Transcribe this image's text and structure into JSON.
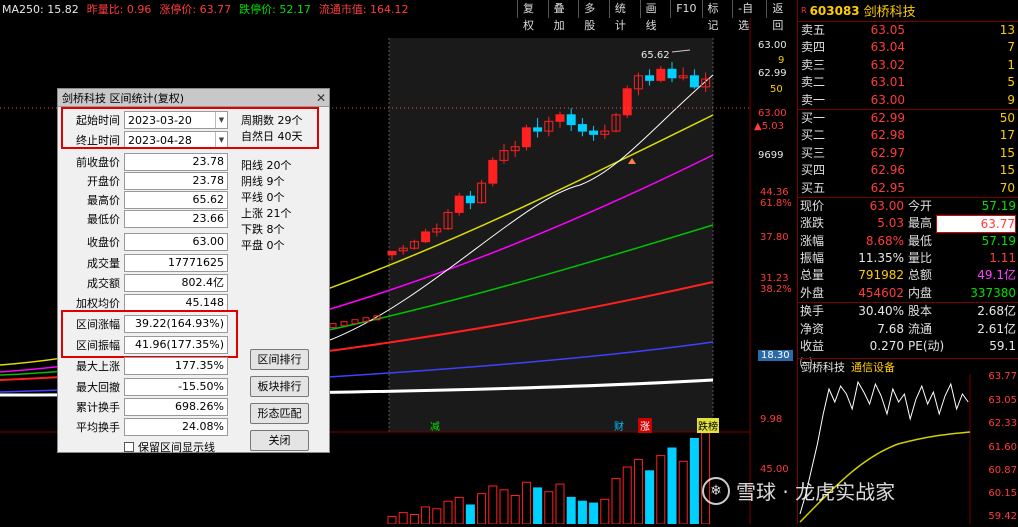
{
  "topbar": {
    "ma250": "MA250: 15.82",
    "prev_close_ratio": "昨量比: 0.96",
    "limit_up": "涨停价: 63.77",
    "limit_down": "跌停价: 52.17",
    "float_value": "流通市值: 164.12"
  },
  "toolbar": [
    "复权",
    "叠加",
    "多股",
    "统计",
    "画线",
    "F10",
    "标记",
    "-自选",
    "返回"
  ],
  "price_axis": [
    "63.00",
    "62.99",
    "50",
    "9",
    "63.00",
    "▲5.03",
    "9699",
    "44.36",
    "61.8%",
    "37.80",
    "31.23",
    "38.2%",
    "18.30",
    "9.98",
    "45.00"
  ],
  "chart": {
    "high_label": "65.62",
    "markers": [
      "减",
      "财",
      "涨",
      "跌榜"
    ],
    "colors": {
      "up": "#ff2020",
      "down": "#00d0ff",
      "ma5": "#ffffff",
      "ma10": "#ffff00",
      "ma20": "#ff00ff",
      "ma60": "#00c000",
      "ma120": "#ff3030",
      "ma250": "#4040ff"
    },
    "candles": [
      [
        36,
        36.5,
        35.2,
        36.6
      ],
      [
        36.6,
        37,
        36,
        37.5
      ],
      [
        37,
        38,
        36.8,
        38.3
      ],
      [
        38,
        39.5,
        37.8,
        40
      ],
      [
        39.5,
        40,
        38.8,
        40.8
      ],
      [
        40,
        42.5,
        39.8,
        43
      ],
      [
        42.5,
        45,
        42,
        45.5
      ],
      [
        45,
        44,
        43,
        45.8
      ],
      [
        44,
        47,
        43.8,
        47.5
      ],
      [
        47,
        50.5,
        46.5,
        51
      ],
      [
        50.5,
        52,
        50,
        53
      ],
      [
        52,
        52.6,
        51,
        53.5
      ],
      [
        52.6,
        55.5,
        52,
        56
      ],
      [
        55.5,
        55,
        54,
        57
      ],
      [
        55,
        56.5,
        54.2,
        57.2
      ],
      [
        56.5,
        57.5,
        55.5,
        58
      ],
      [
        57.5,
        56,
        55,
        58.5
      ],
      [
        56,
        55,
        54.2,
        57
      ],
      [
        55,
        54.5,
        53.5,
        55.8
      ],
      [
        54.5,
        55,
        53.8,
        56
      ],
      [
        55,
        57.5,
        54.8,
        57.8
      ],
      [
        57.5,
        61.5,
        57,
        62
      ],
      [
        61.5,
        63.5,
        60.5,
        64
      ],
      [
        63.5,
        62.8,
        62,
        64.5
      ],
      [
        62.8,
        64.5,
        62.5,
        65
      ],
      [
        64.5,
        63.2,
        62.5,
        65.62
      ],
      [
        63.2,
        63.5,
        62.8,
        64.8
      ],
      [
        63.5,
        61.8,
        61.5,
        64.5
      ],
      [
        61.8,
        63,
        61,
        64
      ]
    ]
  },
  "quote": {
    "code": "603083",
    "name": "剑桥科技",
    "tag": "R",
    "asks": [
      {
        "label": "卖五",
        "price": "63.05",
        "vol": "13"
      },
      {
        "label": "卖四",
        "price": "63.04",
        "vol": "7"
      },
      {
        "label": "卖三",
        "price": "63.02",
        "vol": "1"
      },
      {
        "label": "卖二",
        "price": "63.01",
        "vol": "5"
      },
      {
        "label": "卖一",
        "price": "63.00",
        "vol": "9"
      }
    ],
    "bids": [
      {
        "label": "买一",
        "price": "62.99",
        "vol": "50"
      },
      {
        "label": "买二",
        "price": "62.98",
        "vol": "17"
      },
      {
        "label": "买三",
        "price": "62.97",
        "vol": "15"
      },
      {
        "label": "买四",
        "price": "62.96",
        "vol": "15"
      },
      {
        "label": "买五",
        "price": "62.95",
        "vol": "70"
      }
    ],
    "stats1": [
      {
        "a": "现价",
        "b": "63.00",
        "c": "今开",
        "d": "57.19"
      },
      {
        "a": "涨跌",
        "b": "5.03",
        "c": "最高",
        "d": "63.77"
      },
      {
        "a": "涨幅",
        "b": "8.68%",
        "c": "最低",
        "d": "57.19"
      },
      {
        "a": "振幅",
        "b": "11.35%",
        "c": "量比",
        "d": "1.11"
      },
      {
        "a": "总量",
        "b": "791982",
        "c": "总额",
        "d": "49.1亿"
      },
      {
        "a": "外盘",
        "b": "454602",
        "c": "内盘",
        "d": "337380"
      }
    ],
    "stats2": [
      {
        "a": "换手",
        "b": "30.40%",
        "c": "股本",
        "d": "2.68亿"
      },
      {
        "a": "净资",
        "b": "7.68",
        "c": "流通",
        "d": "2.61亿"
      },
      {
        "a": "收益㈠",
        "b": "0.270",
        "c": "PE(动)",
        "d": "59.1"
      }
    ],
    "mini_title": "剑桥科技",
    "mini_sector": "通信设备",
    "mini_axis": [
      "63.77",
      "63.05",
      "62.33",
      "61.60",
      "60.87",
      "60.15",
      "59.42"
    ]
  },
  "dialog": {
    "title": "剑桥科技 区间统计(复权)",
    "close": "✕",
    "start_label": "起始时间",
    "start_value": "2023-03-20",
    "end_label": "终止时间",
    "end_value": "2023-04-28",
    "period_count": "周期数 29个",
    "natural_days": "自然日 40天",
    "fields": [
      {
        "label": "前收盘价",
        "value": "23.78"
      },
      {
        "label": "开盘价",
        "value": "23.78"
      },
      {
        "label": "最高价",
        "value": "65.62"
      },
      {
        "label": "最低价",
        "value": "23.66"
      },
      {
        "label": "收盘价",
        "value": "63.00"
      },
      {
        "label": "成交量",
        "value": "17771625"
      },
      {
        "label": "成交额",
        "value": "802.4亿"
      },
      {
        "label": "加权均价",
        "value": "45.148"
      },
      {
        "label": "区间涨幅",
        "value": "39.22(164.93%)"
      },
      {
        "label": "区间振幅",
        "value": "41.96(177.35%)"
      },
      {
        "label": "最大上涨",
        "value": "177.35%"
      },
      {
        "label": "最大回撤",
        "value": "-15.50%"
      },
      {
        "label": "累计换手",
        "value": "698.26%"
      },
      {
        "label": "平均换手",
        "value": "24.08%"
      }
    ],
    "counts": [
      "阳线 20个",
      "阴线 9个",
      "平线 0个",
      "上涨 21个",
      "下跌 8个",
      "平盘 0个"
    ],
    "buttons": [
      "区间排行",
      "板块排行",
      "形态匹配",
      "关闭"
    ],
    "checkbox_label": "保留区间显示线"
  },
  "watermark": "雪球 · 龙虎实战家"
}
